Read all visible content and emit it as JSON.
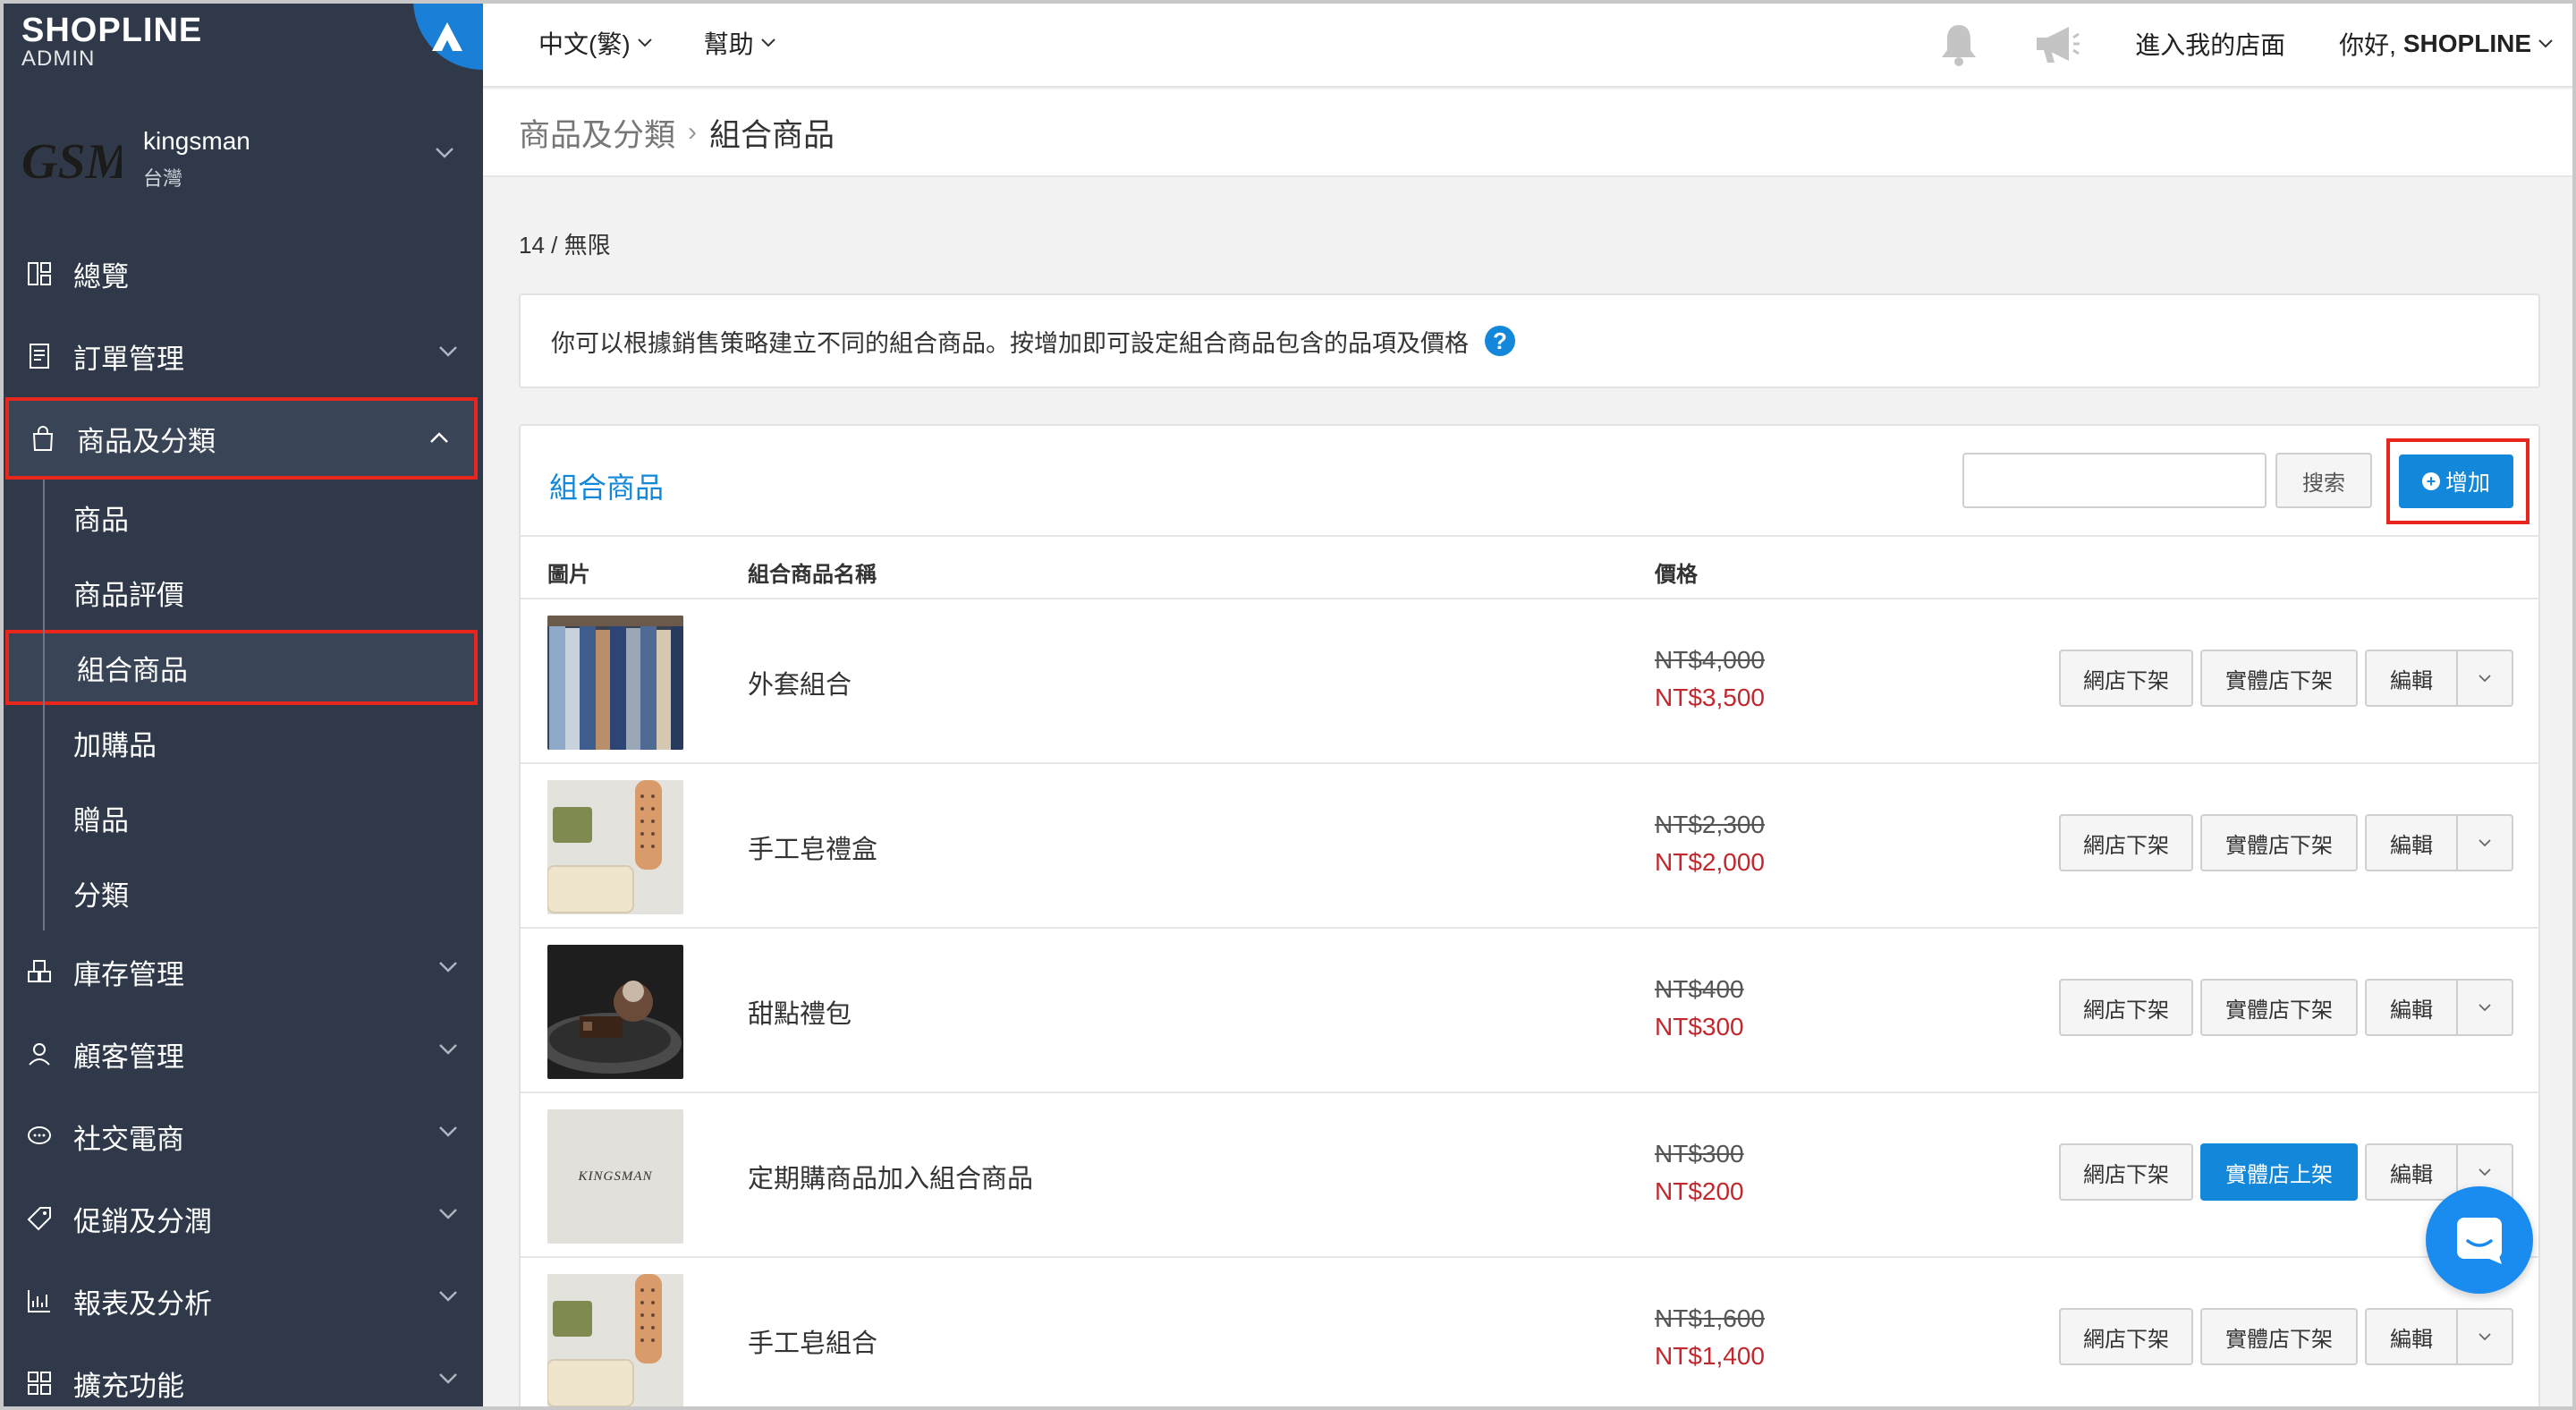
{
  "brand": {
    "name": "SHOPLINE",
    "sub": "ADMIN"
  },
  "account": {
    "logo_text": "GSM",
    "name": "kingsman",
    "region": "台灣"
  },
  "sidebar": {
    "items": [
      {
        "label": "總覽",
        "icon": "dashboard-icon"
      },
      {
        "label": "訂單管理",
        "icon": "orders-icon"
      },
      {
        "label": "商品及分類",
        "icon": "shopping-bag-icon",
        "active": true
      },
      {
        "label": "庫存管理",
        "icon": "inventory-icon"
      },
      {
        "label": "顧客管理",
        "icon": "customer-icon"
      },
      {
        "label": "社交電商",
        "icon": "chat-bubble-icon"
      },
      {
        "label": "促銷及分潤",
        "icon": "tag-icon"
      },
      {
        "label": "報表及分析",
        "icon": "report-chart-icon"
      },
      {
        "label": "擴充功能",
        "icon": "apps-grid-icon"
      }
    ],
    "sub_items": [
      "商品",
      "商品評價",
      "組合商品",
      "加購品",
      "贈品",
      "分類"
    ],
    "active_sub": "組合商品"
  },
  "topbar": {
    "language": "中文(繁)",
    "help": "幫助",
    "store_link": "進入我的店面",
    "greeting": "你好,",
    "user": "SHOPLINE"
  },
  "breadcrumb": {
    "parent": "商品及分類",
    "separator": "›",
    "current": "組合商品"
  },
  "quota": "14 / 無限",
  "info": "你可以根據銷售策略建立不同的組合商品。按增加即可設定組合商品包含的品項及價格",
  "panel": {
    "title": "組合商品",
    "search_value": "",
    "search_label": "搜索",
    "add_label": "增加"
  },
  "table": {
    "headers": {
      "image": "圖片",
      "name": "組合商品名稱",
      "price": "價格"
    },
    "rows": [
      {
        "name": "外套組合",
        "original_price": "NT$4,000",
        "sale_price": "NT$3,500",
        "image": "coats",
        "online_btn": "網店下架",
        "retail_btn": "實體店下架",
        "retail_primary": false,
        "edit": "編輯"
      },
      {
        "name": "手工皂禮盒",
        "original_price": "NT$2,300",
        "sale_price": "NT$2,000",
        "image": "soap",
        "online_btn": "網店下架",
        "retail_btn": "實體店下架",
        "retail_primary": false,
        "edit": "編輯"
      },
      {
        "name": "甜點禮包",
        "original_price": "NT$400",
        "sale_price": "NT$300",
        "image": "dessert",
        "online_btn": "網店下架",
        "retail_btn": "實體店下架",
        "retail_primary": false,
        "edit": "編輯"
      },
      {
        "name": "定期購商品加入組合商品",
        "original_price": "NT$300",
        "sale_price": "NT$200",
        "image": "kingsman",
        "image_text": "KINGSMAN",
        "online_btn": "網店下架",
        "retail_btn": "實體店上架",
        "retail_primary": true,
        "edit": "編輯"
      },
      {
        "name": "手工皂組合",
        "original_price": "NT$1,600",
        "sale_price": "NT$1,400",
        "image": "soap",
        "online_btn": "網店下架",
        "retail_btn": "實體店下架",
        "retail_primary": false,
        "edit": "編輯"
      }
    ]
  },
  "colors": {
    "sidebar_bg": "#2f3949",
    "accent": "#1387d9",
    "sale_price": "#c0282d",
    "highlight": "#e8261b"
  }
}
